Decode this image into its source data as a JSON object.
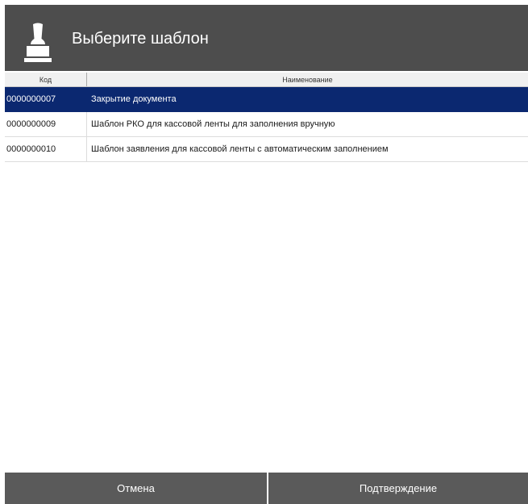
{
  "header": {
    "title": "Выберите шаблон",
    "icon": "stamp-icon"
  },
  "table": {
    "columns": [
      "Код",
      "Наименование"
    ],
    "rows": [
      {
        "code": "0000000007",
        "name": "Закрытие документа",
        "selected": true
      },
      {
        "code": "0000000009",
        "name": "Шаблон РКО для кассовой ленты для заполнения вручную",
        "selected": false
      },
      {
        "code": "0000000010",
        "name": "Шаблон заявления для кассовой ленты с автоматическим заполнением",
        "selected": false
      }
    ]
  },
  "footer": {
    "cancel_label": "Отмена",
    "confirm_label": "Подтверждение"
  },
  "colors": {
    "header_bg": "#4d4d4d",
    "selection": "#0b2870",
    "button_bg": "#5a5a5a"
  }
}
